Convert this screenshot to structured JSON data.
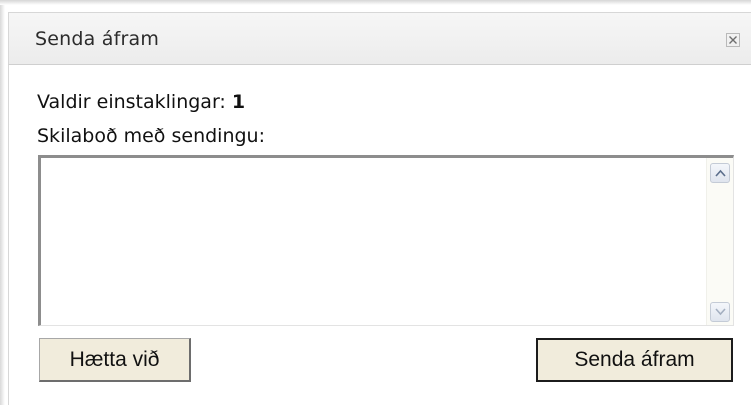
{
  "dialog": {
    "title": "Senda áfram",
    "close_icon": "close-icon"
  },
  "content": {
    "selected_label": "Valdir einstaklingar:",
    "selected_count": "1",
    "message_label": "Skilaboð með sendingu:",
    "message_value": "",
    "message_placeholder": ""
  },
  "buttons": {
    "cancel_label": "Hætta við",
    "send_label": "Senda áfram"
  },
  "colors": {
    "button_bg": "#f1ecdc",
    "titlebar_bg": "#f0f0f0"
  }
}
